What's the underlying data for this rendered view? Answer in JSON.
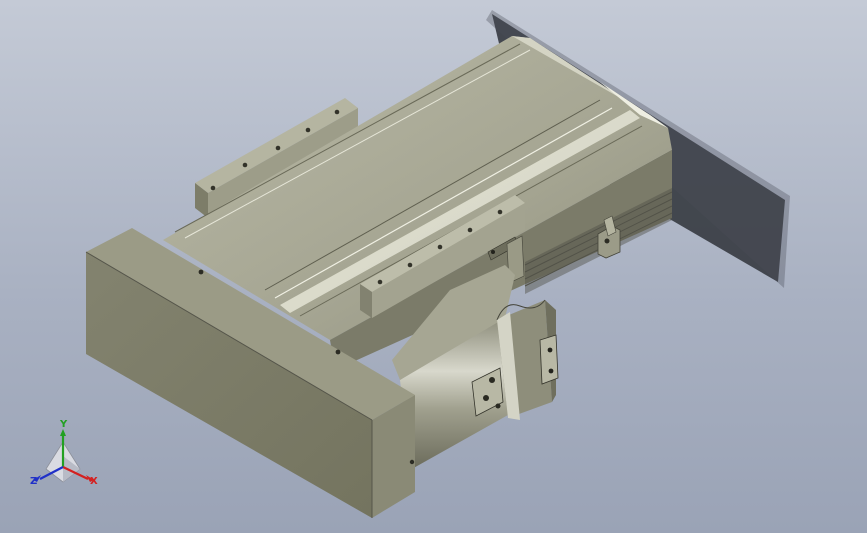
{
  "viewport": {
    "background_top": "#c4cad6",
    "background_bottom": "#9aa3b6"
  },
  "model": {
    "part_color": "#a8a894",
    "dark_face_color": "#7a7a68",
    "shadow_color": "#3a3e46",
    "highlight_color": "#e8e8da"
  },
  "triad": {
    "x_label": "X",
    "y_label": "Y",
    "z_label": "Z",
    "x_color": "#d42020",
    "y_color": "#22a022",
    "z_color": "#2030c8"
  }
}
